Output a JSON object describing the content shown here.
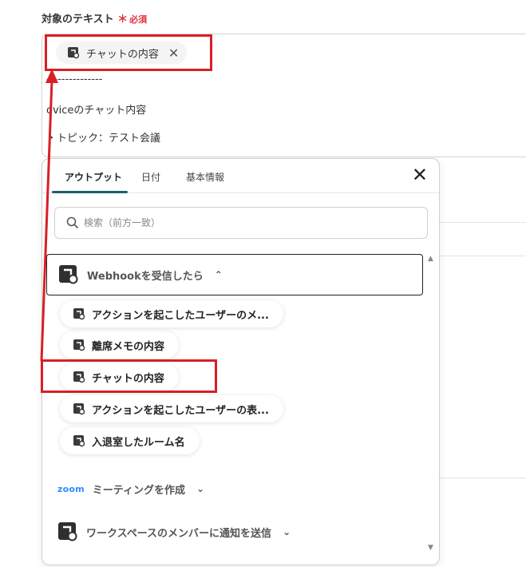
{
  "field": {
    "label": "対象のテキスト",
    "required_mark": "＊",
    "required_text": "必須",
    "chip_label": "チャットの内容",
    "close_glyph": "✕",
    "line1": "---------------",
    "line2": "oviceのチャット内容",
    "line3": "・トピック：テスト会議"
  },
  "popup": {
    "tabs": [
      {
        "label": "アウトプット"
      },
      {
        "label": "日付"
      },
      {
        "label": "基本情報"
      }
    ],
    "close_glyph": "✕",
    "search_placeholder": "検索（前方一致）",
    "webhook_section": {
      "label": "Webhookを受信したら",
      "chevron": "⌃"
    },
    "items": [
      {
        "label": "アクションを起こしたユーザーのメ..."
      },
      {
        "label": "離席メモの内容"
      },
      {
        "label": "チャットの内容"
      },
      {
        "label": "アクションを起こしたユーザーの表..."
      },
      {
        "label": "入退室したルーム名"
      }
    ],
    "zoom_section": {
      "logo": "zoom",
      "label": "ミーティングを作成",
      "chevron": "⌄"
    },
    "ovice_section": {
      "label": "ワークスペースのメンバーに通知を送信",
      "chevron": "⌄"
    }
  },
  "colors": {
    "accent": "#1c5f72",
    "highlight": "#d91f26",
    "required": "#e0303a",
    "zoom": "#2d8cff"
  }
}
